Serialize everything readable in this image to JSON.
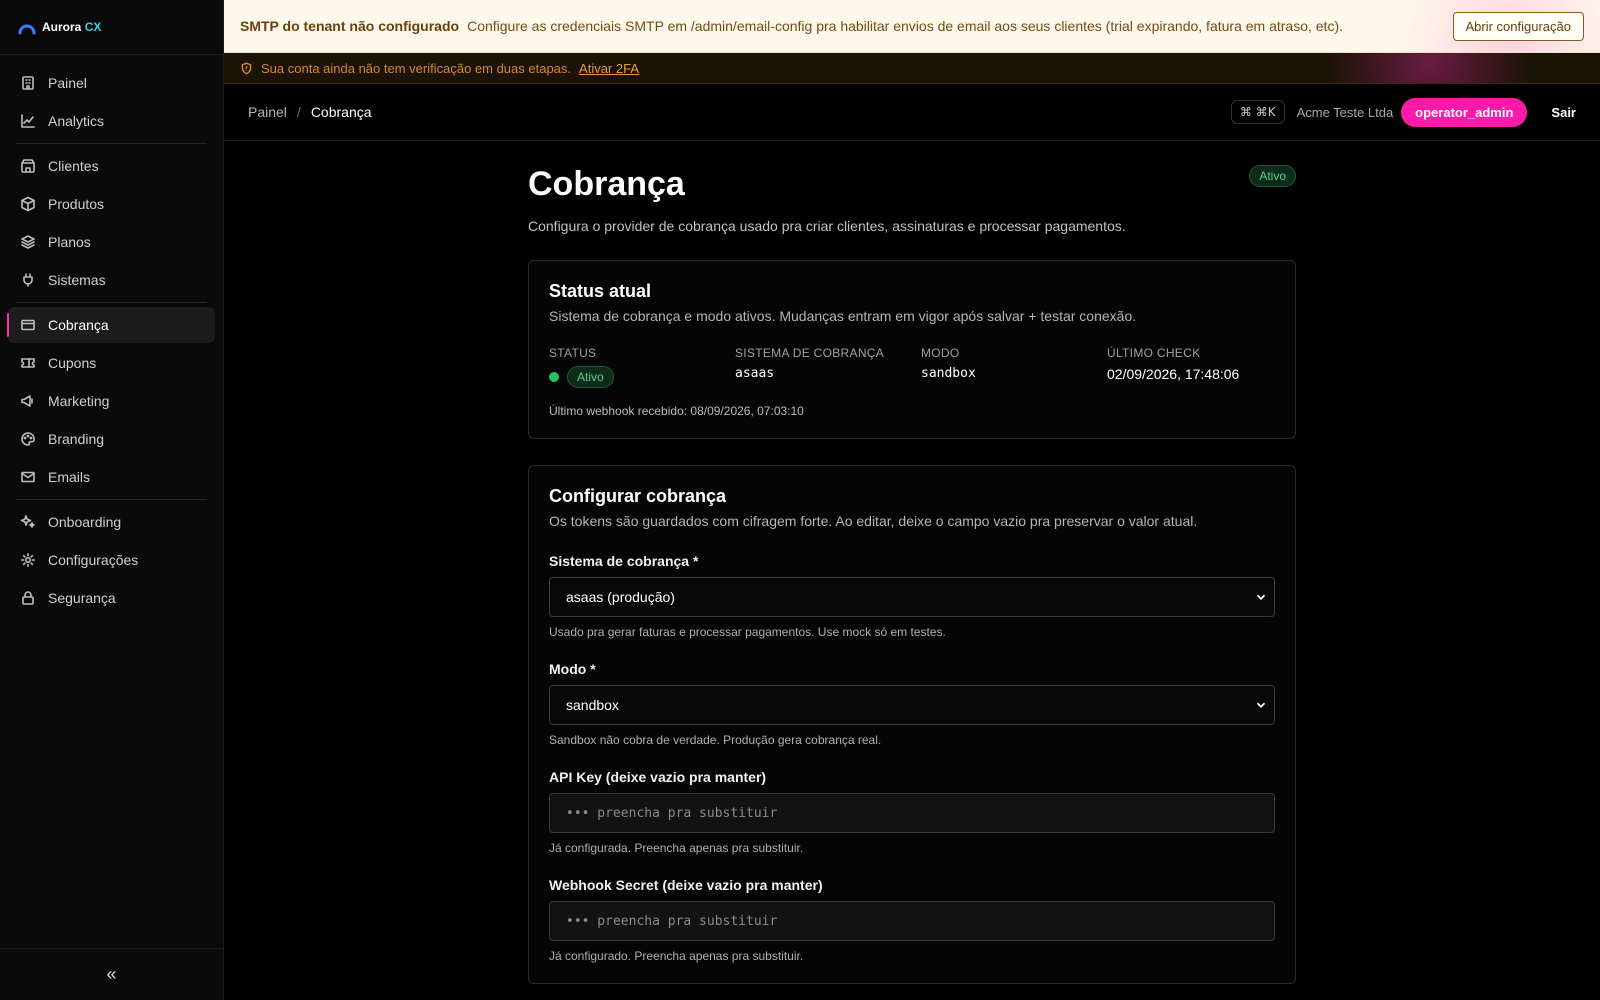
{
  "brand": {
    "name": "Aurora",
    "suffix": "CX"
  },
  "sidebar": {
    "items": [
      {
        "label": "Painel"
      },
      {
        "label": "Analytics"
      },
      {
        "label": "Clientes"
      },
      {
        "label": "Produtos"
      },
      {
        "label": "Planos"
      },
      {
        "label": "Sistemas"
      },
      {
        "label": "Cobrança"
      },
      {
        "label": "Cupons"
      },
      {
        "label": "Marketing"
      },
      {
        "label": "Branding"
      },
      {
        "label": "Emails"
      },
      {
        "label": "Onboarding"
      },
      {
        "label": "Configurações"
      },
      {
        "label": "Segurança"
      }
    ],
    "active": "Cobrança",
    "collapse_glyph": "«"
  },
  "smtp_banner": {
    "title": "SMTP do tenant não configurado",
    "text": "Configure as credenciais SMTP em /admin/email-config pra habilitar envios de email aos seus clientes (trial expirando, fatura em atraso, etc).",
    "button": "Abrir configuração"
  },
  "twofa_banner": {
    "text": "Sua conta ainda não tem verificação em duas etapas.",
    "link": "Ativar 2FA"
  },
  "topbar": {
    "breadcrumb": {
      "root": "Painel",
      "sep": "/",
      "current": "Cobrança"
    },
    "shortcut": "⌘ ⌘K",
    "tenant": "Acme Teste Ltda",
    "role": "operator_admin",
    "logout": "Sair"
  },
  "page": {
    "title": "Cobrança",
    "subtitle": "Configura o provider de cobrança usado pra criar clientes, assinaturas e processar pagamentos.",
    "badge": "Ativo"
  },
  "status_card": {
    "title": "Status atual",
    "subtitle": "Sistema de cobrança e modo ativos. Mudanças entram em vigor após salvar + testar conexão.",
    "labels": {
      "status": "STATUS",
      "system": "SISTEMA DE COBRANÇA",
      "mode": "MODO",
      "last_check": "ÚLTIMO CHECK"
    },
    "values": {
      "status": "Ativo",
      "system": "asaas",
      "mode": "sandbox",
      "last_check": "02/09/2026, 17:48:06"
    },
    "webhook": "Último webhook recebido: 08/09/2026, 07:03:10",
    "status_color": "#22c55e"
  },
  "config_card": {
    "title": "Configurar cobrança",
    "subtitle": "Os tokens são guardados com cifragem forte. Ao editar, deixe o campo vazio pra preservar o valor atual.",
    "system": {
      "label": "Sistema de cobrança *",
      "value": "asaas (produção)",
      "help": "Usado pra gerar faturas e processar pagamentos. Use mock só em testes."
    },
    "mode": {
      "label": "Modo *",
      "value": "sandbox",
      "help": "Sandbox não cobra de verdade. Produção gera cobrança real."
    },
    "api_key": {
      "label": "API Key (deixe vazio pra manter)",
      "placeholder": "••• preencha pra substituir",
      "help": "Já configurada. Preencha apenas pra substituir."
    },
    "webhook_secret": {
      "label": "Webhook Secret (deixe vazio pra manter)",
      "placeholder": "••• preencha pra substituir",
      "help": "Já configurado. Preencha apenas pra substituir."
    }
  },
  "colors": {
    "accent": "#ff1aa9",
    "success": "#22c55e",
    "warning": "#d8862a"
  }
}
